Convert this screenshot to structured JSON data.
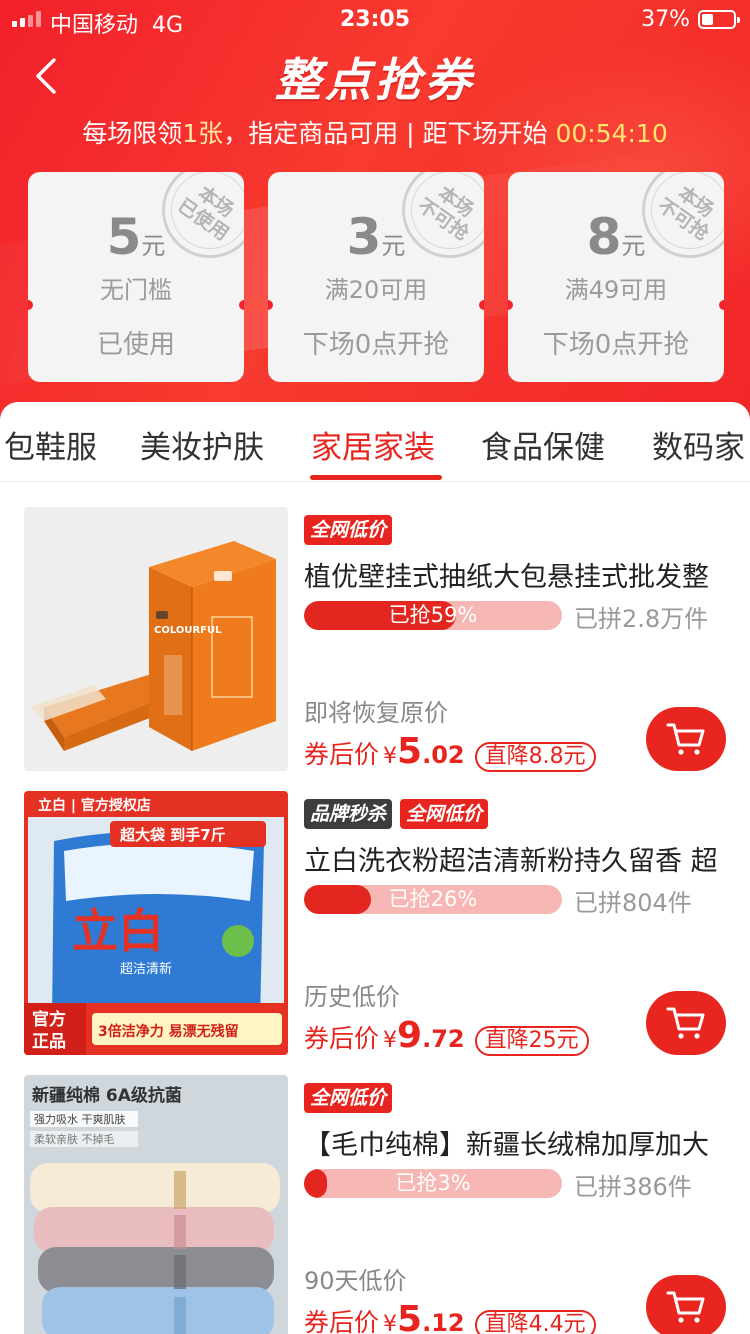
{
  "status_bar": {
    "carrier": "中国移动",
    "network": "4G",
    "time": "23:05",
    "battery": "37%"
  },
  "header": {
    "title": "整点抢券",
    "rule_prefix": "每场限领",
    "rule_count": "1张",
    "rule_mid": "，指定商品可用 | 距下场开始 ",
    "countdown": "00:54:10"
  },
  "coupons": [
    {
      "amount": "5",
      "unit": "元",
      "condition": "无门槛",
      "state": "已使用",
      "stamp_top": "本场",
      "stamp_bottom": "已使用"
    },
    {
      "amount": "3",
      "unit": "元",
      "condition": "满20可用",
      "state": "下场0点开抢",
      "stamp_top": "本场",
      "stamp_bottom": "不可抢"
    },
    {
      "amount": "8",
      "unit": "元",
      "condition": "满49可用",
      "state": "下场0点开抢",
      "stamp_top": "本场",
      "stamp_bottom": "不可抢"
    }
  ],
  "tabs": [
    {
      "label": "包鞋服"
    },
    {
      "label": "美妆护肤"
    },
    {
      "label": "家居家装",
      "active": true
    },
    {
      "label": "食品保健"
    },
    {
      "label": "数码家"
    }
  ],
  "products": [
    {
      "tags": [
        "全网低价"
      ],
      "title": "植优壁挂式抽纸大包悬挂式批发整",
      "progress_label": "已抢59%",
      "progress": 0.59,
      "sold": "已拼2.8万件",
      "hint": "即将恢复原价",
      "price_label": "券后价",
      "currency": "¥",
      "price_int": "5",
      "price_dec": ".02",
      "discount": "直降8.8元",
      "image": {
        "brand": "COLOURFUL"
      }
    },
    {
      "tags": [
        "品牌秒杀",
        "全网低价"
      ],
      "title": "立白洗衣粉超洁清新粉持久留香 超",
      "progress_label": "已抢26%",
      "progress": 0.26,
      "sold": "已拼804件",
      "hint": "历史低价",
      "price_label": "券后价",
      "currency": "¥",
      "price_int": "9",
      "price_dec": ".72",
      "discount": "直降25元",
      "image": {
        "store": "立白 | 官方授权店",
        "banner": "超大袋 到手7斤",
        "brand": "立白",
        "sub": "超洁清新",
        "badge": "官方\n正品",
        "slogan": "3倍洁净力 易漂无残留"
      }
    },
    {
      "tags": [
        "全网低价"
      ],
      "title": "【毛巾纯棉】新疆长绒棉加厚加大",
      "progress_label": "已抢3%",
      "progress": 0.03,
      "sold": "已拼386件",
      "hint": "90天低价",
      "price_label": "券后价",
      "currency": "¥",
      "price_int": "5",
      "price_dec": ".12",
      "discount": "直降4.4元",
      "image": {
        "headline": "新疆纯棉 6A级抗菌",
        "feature1": "强力吸水 干爽肌肤",
        "feature2": "柔软亲肤 不掉毛"
      }
    }
  ],
  "colors": {
    "brand_red": "#e8241e",
    "header_red": "#f2202a",
    "progress_track": "#f7b7b5"
  }
}
